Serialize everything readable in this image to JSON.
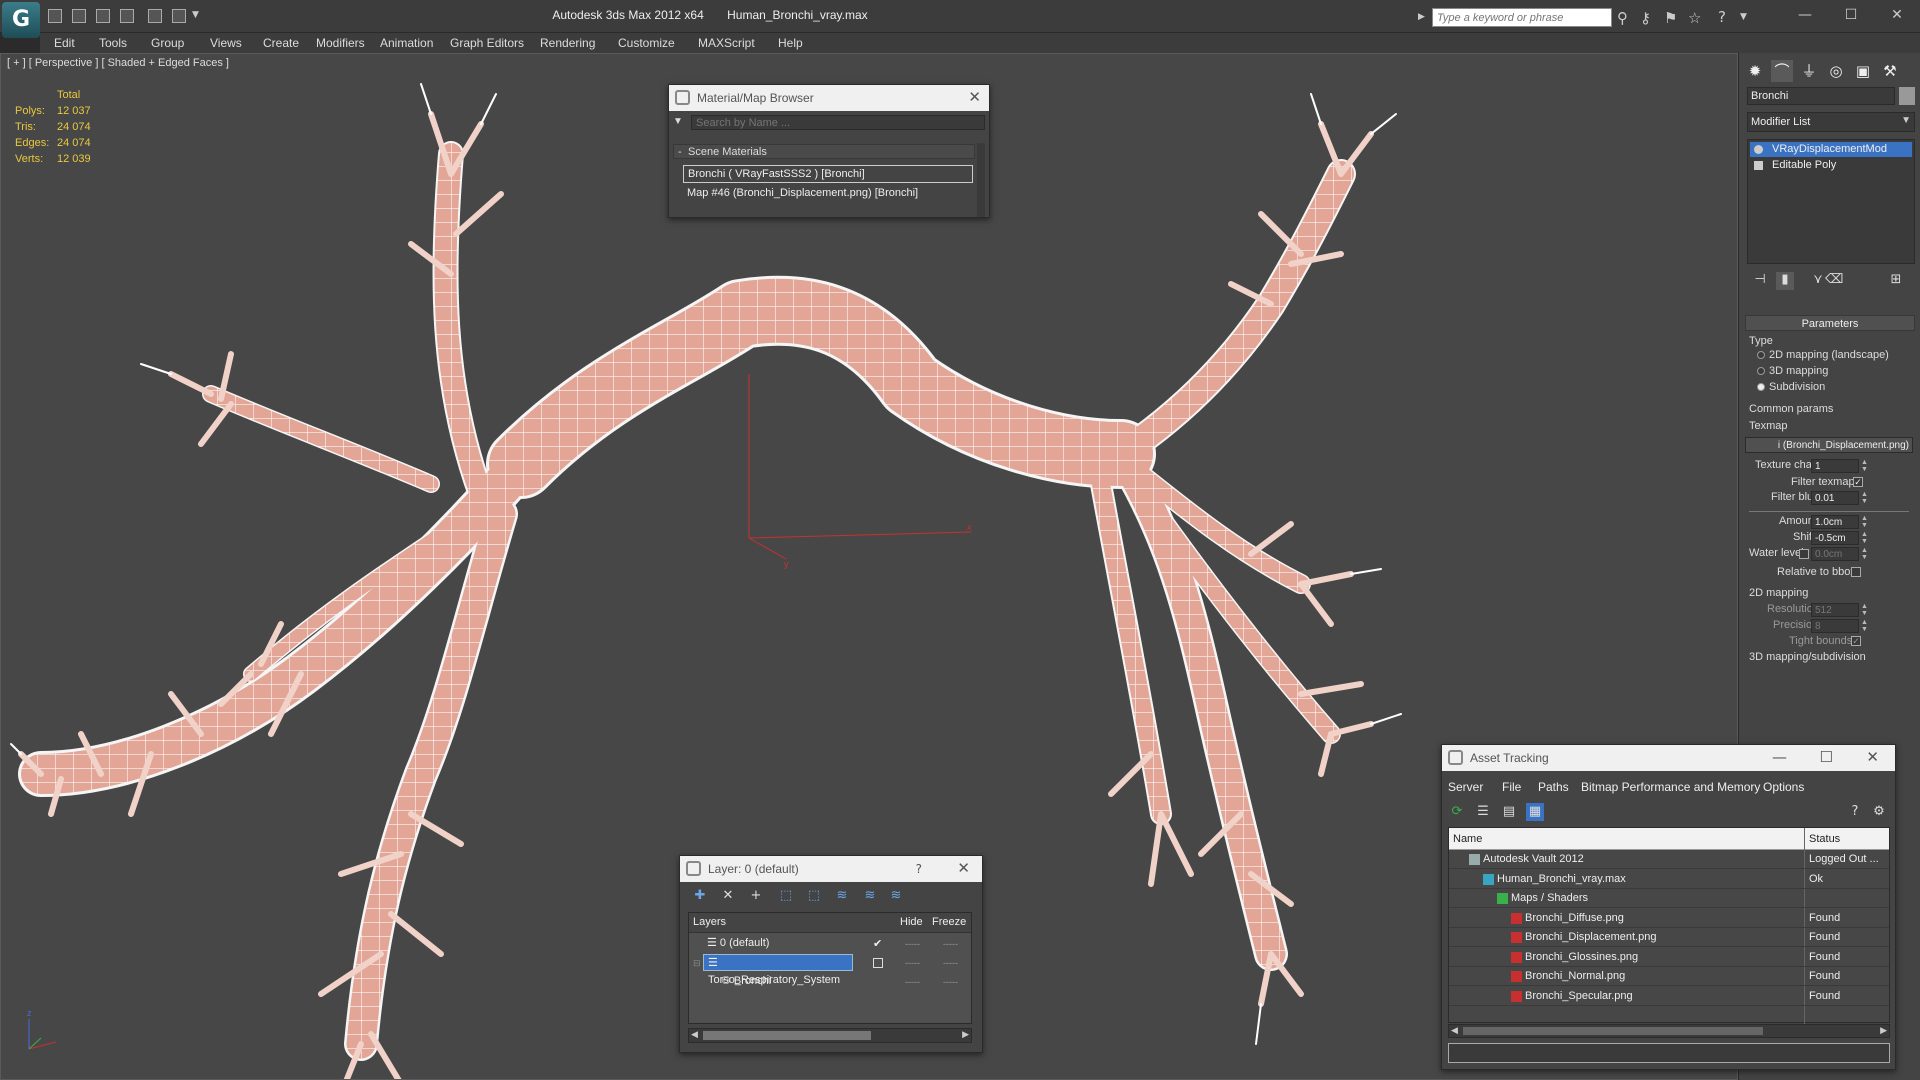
{
  "titlebar": {
    "app_title": "Autodesk 3ds Max  2012 x64",
    "file_name": "Human_Bronchi_vray.max",
    "search_placeholder": "Type a keyword or phrase"
  },
  "menu": [
    "Edit",
    "Tools",
    "Group",
    "Views",
    "Create",
    "Modifiers",
    "Animation",
    "Graph Editors",
    "Rendering",
    "Customize",
    "MAXScript",
    "Help"
  ],
  "viewport": {
    "label": "[ + ] [ Perspective ] [ Shaded + Edged Faces ]",
    "stats": {
      "header": "Total",
      "rows": [
        {
          "label": "Polys:",
          "value": "12 037"
        },
        {
          "label": "Tris:",
          "value": "24 074"
        },
        {
          "label": "Edges:",
          "value": "24 074"
        },
        {
          "label": "Verts:",
          "value": "12 039"
        }
      ]
    },
    "axis_labels": {
      "x": "x",
      "y": "y",
      "z": "z"
    }
  },
  "command_panel": {
    "object_name": "Bronchi",
    "modifier_list": "Modifier List",
    "stack": [
      "VRayDisplacementMod",
      "Editable Poly"
    ],
    "parameters": {
      "title": "Parameters",
      "type_label": "Type",
      "type_options": [
        "2D mapping (landscape)",
        "3D mapping",
        "Subdivision"
      ],
      "selected_type": "Subdivision",
      "common_params": "Common params",
      "texmap_label": "Texmap",
      "texmap_value": "i (Bronchi_Displacement.png)",
      "texture_chan_label": "Texture chan",
      "texture_chan_value": "1",
      "filter_texmap_label": "Filter texmap",
      "filter_blur_label": "Filter blur",
      "filter_blur_value": "0.01",
      "amount_label": "Amount",
      "amount_value": "1.0cm",
      "shift_label": "Shift",
      "shift_value": "-0.5cm",
      "water_level_label": "Water level",
      "water_level_value": "0.0cm",
      "relative_bbox_label": "Relative to bbox",
      "mapping2d_title": "2D mapping",
      "resolution_label": "Resolution",
      "resolution_value": "512",
      "precision_label": "Precision",
      "precision_value": "8",
      "tight_bounds_label": "Tight bounds",
      "mapping3d_title": "3D mapping/subdivision"
    }
  },
  "material_browser": {
    "title": "Material/Map Browser",
    "search_placeholder": "Search by Name ...",
    "group": "Scene Materials",
    "items": [
      "Bronchi  ( VRayFastSSS2 )  [Bronchi]",
      "Map #46 (Bronchi_Displacement.png)  [Bronchi]"
    ]
  },
  "layer_dialog": {
    "title": "Layer: 0 (default)",
    "help": "?",
    "columns": {
      "layers": "Layers",
      "hide": "Hide",
      "freeze": "Freeze"
    },
    "rows": [
      {
        "name": "0 (default)",
        "level": 0,
        "selected": false
      },
      {
        "name": "Torso_Respiratory_System",
        "level": 0,
        "selected": true
      },
      {
        "name": "Bronchi",
        "level": 1,
        "selected": false
      }
    ]
  },
  "asset_tracking": {
    "title": "Asset Tracking",
    "menu": [
      "Server",
      "File",
      "Paths",
      "Bitmap Performance and Memory",
      "Options"
    ],
    "columns": {
      "name": "Name",
      "status": "Status"
    },
    "rows": [
      {
        "name": "Autodesk Vault 2012",
        "status": "Logged Out ...",
        "indent": 1,
        "icon": "vault-icon"
      },
      {
        "name": "Human_Bronchi_vray.max",
        "status": "Ok",
        "indent": 2,
        "icon": "max-file-icon"
      },
      {
        "name": "Maps / Shaders",
        "status": "",
        "indent": 3,
        "icon": "maps-icon"
      },
      {
        "name": "Bronchi_Diffuse.png",
        "status": "Found",
        "indent": 4,
        "icon": "png-icon"
      },
      {
        "name": "Bronchi_Displacement.png",
        "status": "Found",
        "indent": 4,
        "icon": "png-icon"
      },
      {
        "name": "Bronchi_Glossines.png",
        "status": "Found",
        "indent": 4,
        "icon": "png-icon"
      },
      {
        "name": "Bronchi_Normal.png",
        "status": "Found",
        "indent": 4,
        "icon": "png-icon"
      },
      {
        "name": "Bronchi_Specular.png",
        "status": "Found",
        "indent": 4,
        "icon": "png-icon"
      }
    ]
  },
  "colors": {
    "viewport_bg": "#474747",
    "selection": "#3b73c4",
    "stats_text": "#e8c840",
    "bronchi_fill": "#e0a090",
    "wire": "#ffffff"
  }
}
